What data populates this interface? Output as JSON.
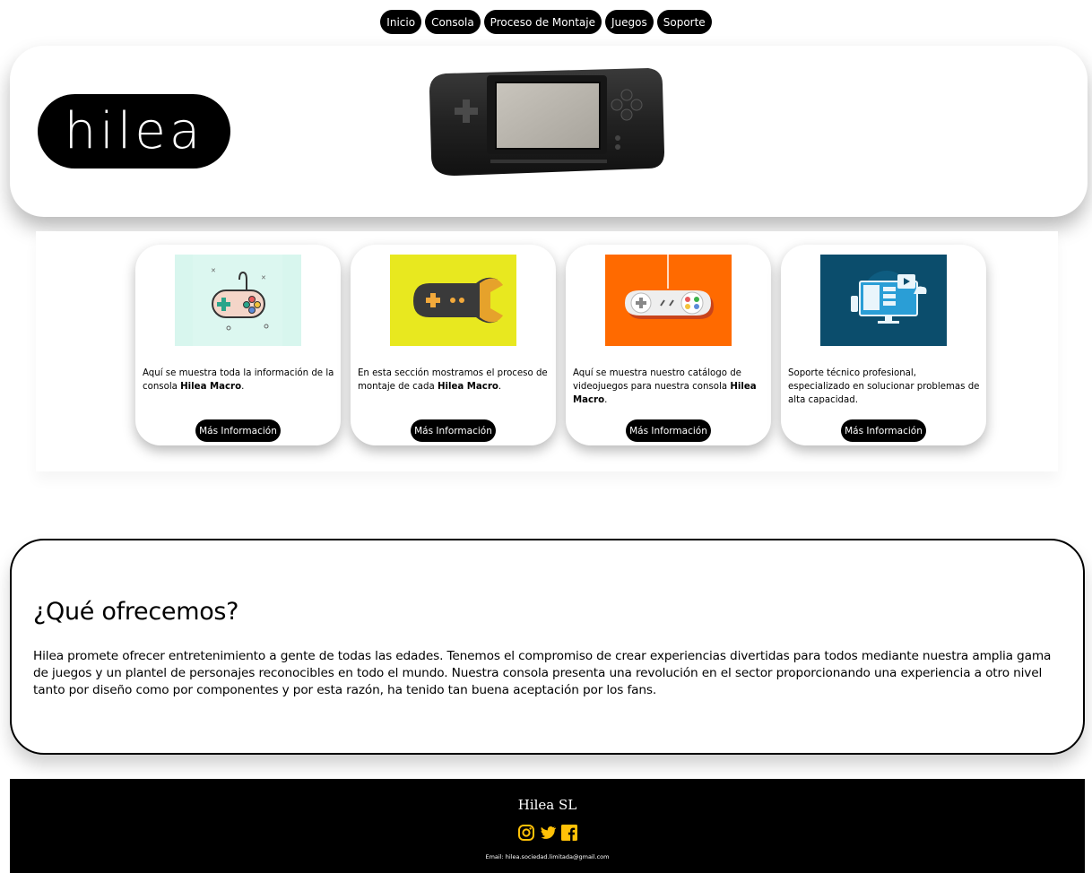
{
  "nav": {
    "items": [
      {
        "label": "Inicio"
      },
      {
        "label": "Consola"
      },
      {
        "label": "Proceso de Montaje"
      },
      {
        "label": "Juegos"
      },
      {
        "label": "Soporte"
      }
    ]
  },
  "hero": {
    "logo_text": "hilea"
  },
  "cards": [
    {
      "text_pre": "Aquí se muestra toda la información de la consola ",
      "text_bold": "Hilea Macro",
      "text_post": ".",
      "button": "Más Información",
      "icon": "gamepad-icon",
      "bg": "#d8f6ee"
    },
    {
      "text_pre": "En esta sección mostramos el proceso de montaje de cada ",
      "text_bold": "Hilea Macro",
      "text_post": ".",
      "button": "Más Información",
      "icon": "wrench-gamepad-icon",
      "bg": "#e8e81f"
    },
    {
      "text_pre": "Aquí se muestra nuestro catálogo de videojuegos para nuestra consola ",
      "text_bold": "Hilea Macro",
      "text_post": ".",
      "button": "Más Información",
      "icon": "controller-icon",
      "bg": "#ff6a00"
    },
    {
      "text_pre": "Soporte técnico profesional, especializado en solucionar problemas de alta capacidad.",
      "text_bold": "",
      "text_post": "",
      "button": "Más Información",
      "icon": "support-monitor-icon",
      "bg": "#0b4d6c"
    }
  ],
  "offer": {
    "title": "¿Qué ofrecemos?",
    "body": "Hilea promete ofrecer entretenimiento a gente de todas las edades. Tenemos el compromiso de crear experiencias divertidas para todos mediante nuestra amplia gama de juegos y un plantel de personajes reconocibles en todo el mundo. Nuestra consola presenta una revolución en el sector proporcionando una experiencia a otro nivel tanto por diseño como por componentes y por esta razón, ha tenido tan buena aceptación por los fans."
  },
  "footer": {
    "title": "Hilea SL",
    "social": [
      "instagram-icon",
      "twitter-icon",
      "facebook-icon"
    ],
    "social_color": "#ffc107",
    "email": "Email: hilea.sociedad.limitada@gmail.com"
  }
}
